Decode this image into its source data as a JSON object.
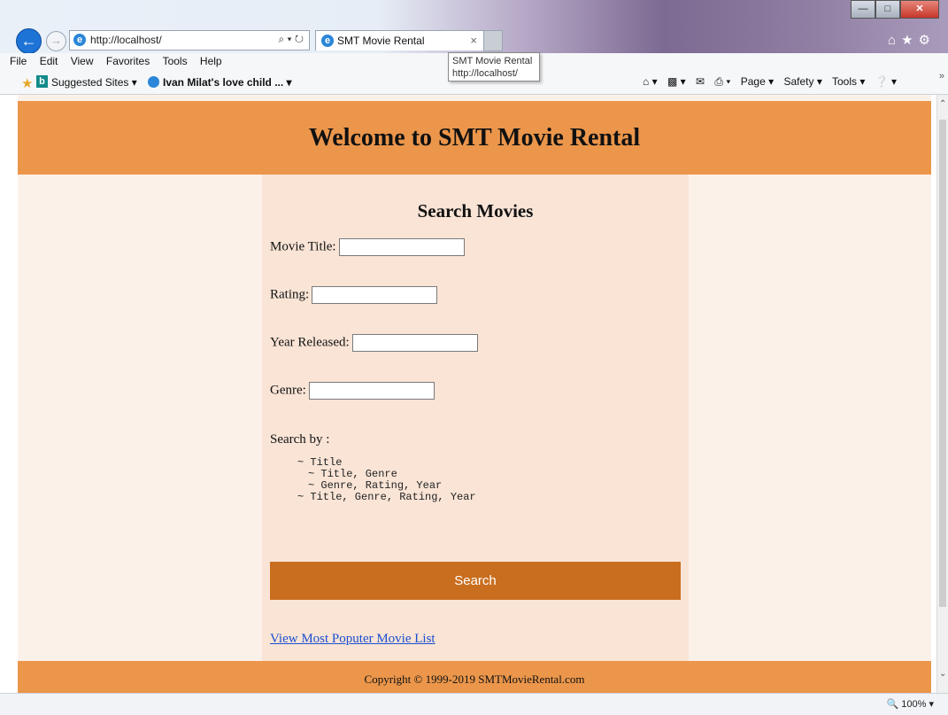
{
  "browser": {
    "url": "http://localhost/",
    "tab_title": "SMT Movie Rental",
    "tab_close": "×",
    "tooltip_title": "SMT Movie Rental",
    "tooltip_url": "http://localhost/",
    "addr_controls": "⌕ ▾ ↻",
    "menu": [
      "File",
      "Edit",
      "View",
      "Favorites",
      "Tools",
      "Help"
    ],
    "favorites": {
      "suggested": "Suggested Sites ▾",
      "link": "Ivan Milat's love child ... ▾"
    },
    "command_bar": {
      "page": "Page ▾",
      "safety": "Safety ▾",
      "tools": "Tools ▾"
    },
    "zoom": "100%",
    "icons": [
      "back-arrow-icon",
      "forward-arrow-icon",
      "ie-icon",
      "home-icon",
      "star-icon",
      "gear-icon"
    ]
  },
  "page": {
    "site_title": "Welcome to SMT Movie Rental",
    "form_heading": "Search Movies",
    "fields": {
      "title_label": "Movie Title:",
      "rating_label": "Rating:",
      "year_label": "Year Released:",
      "genre_label": "Genre:"
    },
    "search_by_label": "Search by :",
    "search_by_lines": [
      "~ Title",
      "~ Title, Genre",
      "~ Genre, Rating, Year",
      "~ Title, Genre, Rating, Year"
    ],
    "search_button": "Search",
    "popular_link": "View Most Poputer Movie List",
    "footer": "Copyright © 1999-2019 SMTMovieRental.com"
  },
  "colors": {
    "header_band": "#eb964b",
    "main_column": "#f9e4d6",
    "page_background": "#fcf1e9",
    "search_button": "#c96d1e",
    "link": "#1a4fd0"
  }
}
